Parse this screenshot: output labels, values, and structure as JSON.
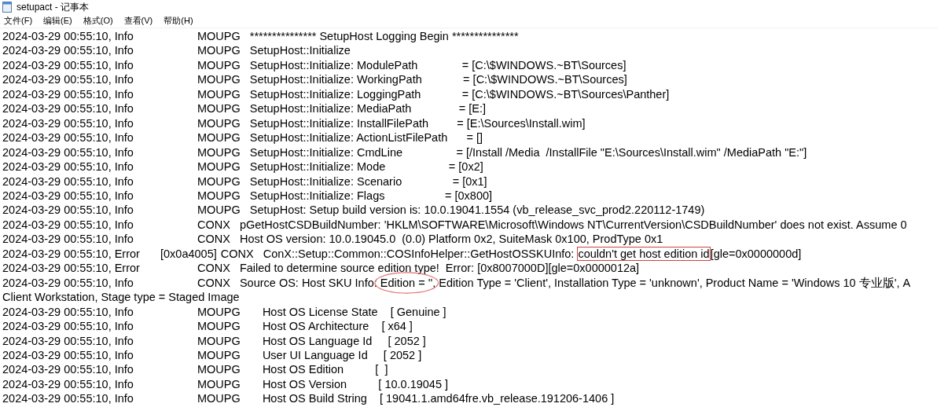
{
  "window": {
    "title": "setupact - 记事本"
  },
  "menu": [
    "文件(F)",
    "编辑(E)",
    "格式(O)",
    "查看(V)",
    "帮助(H)"
  ],
  "lines": [
    {
      "kind": "entry",
      "time": "2024-03-29 00:55:10, Info",
      "source": "MOUPG",
      "message": [
        {
          "text": "*************** SetupHost Logging Begin ***************"
        }
      ]
    },
    {
      "kind": "entry",
      "time": "2024-03-29 00:55:10, Info",
      "source": "MOUPG",
      "message": [
        {
          "text": "SetupHost::Initialize"
        }
      ]
    },
    {
      "kind": "entry",
      "time": "2024-03-29 00:55:10, Info",
      "source": "MOUPG",
      "message": [
        {
          "text": "SetupHost::Initialize: ModulePath              = [C:\\$WINDOWS.~BT\\Sources]"
        }
      ]
    },
    {
      "kind": "entry",
      "time": "2024-03-29 00:55:10, Info",
      "source": "MOUPG",
      "message": [
        {
          "text": "SetupHost::Initialize: WorkingPath             = [C:\\$WINDOWS.~BT\\Sources]"
        }
      ]
    },
    {
      "kind": "entry",
      "time": "2024-03-29 00:55:10, Info",
      "source": "MOUPG",
      "message": [
        {
          "text": "SetupHost::Initialize: LoggingPath             = [C:\\$WINDOWS.~BT\\Sources\\Panther]"
        }
      ]
    },
    {
      "kind": "entry",
      "time": "2024-03-29 00:55:10, Info",
      "source": "MOUPG",
      "message": [
        {
          "text": "SetupHost::Initialize: MediaPath               = [E:]"
        }
      ]
    },
    {
      "kind": "entry",
      "time": "2024-03-29 00:55:10, Info",
      "source": "MOUPG",
      "message": [
        {
          "text": "SetupHost::Initialize: InstallFilePath         = [E:\\Sources\\Install.wim]"
        }
      ]
    },
    {
      "kind": "entry",
      "time": "2024-03-29 00:55:10, Info",
      "source": "MOUPG",
      "message": [
        {
          "text": "SetupHost::Initialize: ActionListFilePath      = []"
        }
      ]
    },
    {
      "kind": "entry",
      "time": "2024-03-29 00:55:10, Info",
      "source": "MOUPG",
      "message": [
        {
          "text": "SetupHost::Initialize: CmdLine                 = [/Install /Media  /InstallFile \"E:\\Sources\\Install.wim\" /MediaPath \"E:\"]"
        }
      ]
    },
    {
      "kind": "entry",
      "time": "2024-03-29 00:55:10, Info",
      "source": "MOUPG",
      "message": [
        {
          "text": "SetupHost::Initialize: Mode                    = [0x2]"
        }
      ]
    },
    {
      "kind": "entry",
      "time": "2024-03-29 00:55:10, Info",
      "source": "MOUPG",
      "message": [
        {
          "text": "SetupHost::Initialize: Scenario                = [0x1]"
        }
      ]
    },
    {
      "kind": "entry",
      "time": "2024-03-29 00:55:10, Info",
      "source": "MOUPG",
      "message": [
        {
          "text": "SetupHost::Initialize: Flags                   = [0x800]"
        }
      ]
    },
    {
      "kind": "entry",
      "time": "2024-03-29 00:55:10, Info",
      "source": "MOUPG",
      "message": [
        {
          "text": "SetupHost: Setup build version is: 10.0.19041.1554 (vb_release_svc_prod2.220112-1749)"
        }
      ]
    },
    {
      "kind": "entry",
      "time": "2024-03-29 00:55:10, Info",
      "source": "CONX",
      "message": [
        {
          "text": "pGetHostCSDBuildNumber: 'HKLM\\SOFTWARE\\Microsoft\\Windows NT\\CurrentVersion\\CSDBuildNumber' does not exist. Assume 0"
        }
      ]
    },
    {
      "kind": "entry",
      "time": "2024-03-29 00:55:10, Info",
      "source": "CONX",
      "message": [
        {
          "text": "Host OS version: 10.0.19045.0  (0.0) Platform 0x2, SuiteMask 0x100, ProdType 0x1"
        }
      ]
    },
    {
      "kind": "entry",
      "time": "2024-03-29 00:55:10, Error",
      "code": "[0x0a4005]",
      "source": "CONX",
      "message": [
        {
          "text": "ConX::Setup::Common::COSInfoHelper::GetHostOSSKUInfo: "
        },
        {
          "text": "couldn't get host edition id",
          "kind": "boxed"
        },
        {
          "text": "[gle=0x0000000d]"
        }
      ]
    },
    {
      "kind": "entry",
      "time": "2024-03-29 00:55:10, Error",
      "source": "CONX",
      "message": [
        {
          "text": "Failed to determine source edition type!  Error: [0x8007000D][gle=0x0000012a]"
        }
      ]
    },
    {
      "kind": "entry",
      "time": "2024-03-29 00:55:10, Info",
      "source": "CONX",
      "message": [
        {
          "text": "Source OS: Host SKU Info: "
        },
        {
          "text": "Edition = ''",
          "kind": "circled"
        },
        {
          "text": ", Edition Type = 'Client', Installation Type = 'unknown', Product Name = 'Windows 10 专业版', A"
        }
      ]
    },
    {
      "kind": "continuation",
      "text": "Client Workstation, Stage type = Staged Image"
    },
    {
      "kind": "entry",
      "time": "2024-03-29 00:55:10, Info",
      "source": "MOUPG",
      "message": [
        {
          "text": "    Host OS License State    [ Genuine ]"
        }
      ]
    },
    {
      "kind": "entry",
      "time": "2024-03-29 00:55:10, Info",
      "source": "MOUPG",
      "message": [
        {
          "text": "    Host OS Architecture    [ x64 ]"
        }
      ]
    },
    {
      "kind": "entry",
      "time": "2024-03-29 00:55:10, Info",
      "source": "MOUPG",
      "message": [
        {
          "text": "    Host OS Language Id     [ 2052 ]"
        }
      ]
    },
    {
      "kind": "entry",
      "time": "2024-03-29 00:55:10, Info",
      "source": "MOUPG",
      "message": [
        {
          "text": "    User UI Language Id     [ 2052 ]"
        }
      ]
    },
    {
      "kind": "entry",
      "time": "2024-03-29 00:55:10, Info",
      "source": "MOUPG",
      "message": [
        {
          "text": "    Host OS Edition          [  ]"
        }
      ]
    },
    {
      "kind": "entry",
      "time": "2024-03-29 00:55:10, Info",
      "source": "MOUPG",
      "message": [
        {
          "text": "    Host OS Version          [ 10.0.19045 ]"
        }
      ]
    },
    {
      "kind": "entry",
      "time": "2024-03-29 00:55:10, Info",
      "source": "MOUPG",
      "message": [
        {
          "text": "    Host OS Build String    [ 19041.1.amd64fre.vb_release.191206-1406 ]"
        }
      ]
    }
  ]
}
